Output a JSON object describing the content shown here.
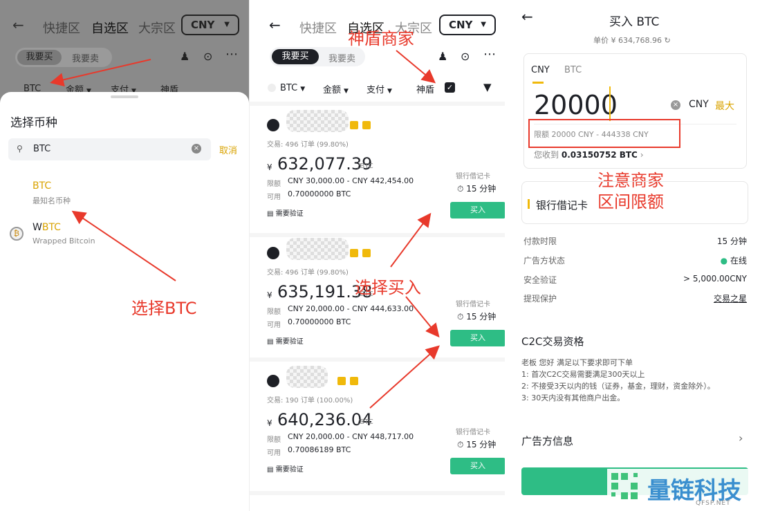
{
  "panel1": {
    "header_tabs": [
      "快捷区",
      "自选区",
      "大宗区"
    ],
    "currency": "CNY",
    "segment": {
      "buy": "我要买",
      "sell": "我要卖"
    },
    "filters": {
      "coin": "BTC",
      "amount": "金额",
      "pay": "支付",
      "shield": "神盾"
    },
    "sheet_title": "选择币种",
    "search_value": "BTC",
    "cancel": "取消",
    "coins": [
      {
        "symbol": "BTC",
        "desc": "最知名币种"
      },
      {
        "symbol_prefix": "W",
        "symbol_hl": "BTC",
        "desc": "Wrapped Bitcoin"
      }
    ],
    "annotation": "选择BTC"
  },
  "panel2": {
    "header_tabs": [
      "快捷区",
      "自选区",
      "大宗区"
    ],
    "currency": "CNY",
    "segment": {
      "buy": "我要买",
      "sell": "我要卖"
    },
    "filters": {
      "coin": "BTC",
      "amount": "金额",
      "pay": "支付",
      "shield": "神盾"
    },
    "annotation_top": "神盾商家",
    "annotation_mid": "选择买入",
    "offers": [
      {
        "stats": "交易: 496 订单 (99.80%)",
        "price": "632,077.39",
        "unit": "/BTC",
        "limit_label": "限额",
        "limit": "CNY 30,000.00 - CNY 442,454.00",
        "avail_label": "可用",
        "avail": "0.70000000 BTC",
        "pay": "银行借记卡",
        "time": "15 分钟",
        "verify": "需要验证",
        "buy": "买入"
      },
      {
        "stats": "交易: 496 订单 (99.80%)",
        "price": "635,191.38",
        "unit": "/BTC",
        "limit_label": "限额",
        "limit": "CNY 20,000.00 - CNY 444,633.00",
        "avail_label": "可用",
        "avail": "0.70000000 BTC",
        "pay": "银行借记卡",
        "time": "15 分钟",
        "verify": "需要验证",
        "buy": "买入"
      },
      {
        "stats": "交易: 190 订单 (100.00%)",
        "price": "640,236.04",
        "unit": "/BTC",
        "limit_label": "限额",
        "limit": "CNY 20,000.00 - CNY 448,717.00",
        "avail_label": "可用",
        "avail": "0.70086189 BTC",
        "pay": "银行借记卡",
        "time": "15 分钟",
        "verify": "需要验证",
        "buy": "买入"
      }
    ],
    "currency_symbol": "¥"
  },
  "panel3": {
    "title": "买入 BTC",
    "unit_price": "单价 ¥ 634,768.96",
    "tabs": [
      "CNY",
      "BTC"
    ],
    "amount": "20000",
    "currency": "CNY",
    "max": "最大",
    "limit_text": "限额 20000 CNY - 444338 CNY",
    "receive_label": "您收到",
    "receive_value": "0.03150752 BTC",
    "annotation": [
      "注意商家",
      "区间限额"
    ],
    "pay_method": "银行借记卡",
    "details": [
      {
        "k": "付款时限",
        "v": "15 分钟"
      },
      {
        "k": "广告方状态",
        "v": "在线"
      },
      {
        "k": "安全验证",
        "v": "> 5,000.00CNY"
      },
      {
        "k": "提现保护",
        "v": "交易之星"
      }
    ],
    "c2c_title": "C2C交易资格",
    "c2c_lines": [
      "老板 您好 满足以下要求即可下单",
      "1: 首次C2C交易需要满足300天以上",
      "2: 不接受3天以内的钱（证券，基金，理财，资金除外）。",
      "3: 30天内没有其他商户出金。"
    ],
    "advertiser_info": "广告方信息"
  },
  "watermark": {
    "name": "量链科技",
    "domain": "QFSP.NET"
  },
  "colors": {
    "accent": "#f0b90b",
    "buy_green": "#2ebd85",
    "annotation_red": "#e8392b",
    "online_green": "#2ebd85"
  }
}
